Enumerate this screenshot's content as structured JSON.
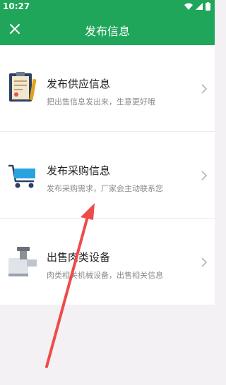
{
  "status_bar": {
    "time": "10:27"
  },
  "app_bar": {
    "title": "发布信息"
  },
  "items": [
    {
      "title": "发布供应信息",
      "subtitle": "把出售信息发出来，生意更好哦"
    },
    {
      "title": "发布采购信息",
      "subtitle": "发布采购需求，厂家会主动联系您"
    },
    {
      "title": "出售肉类设备",
      "subtitle": "肉类相关机械设备，出售相关信息"
    }
  ],
  "colors": {
    "brand": "#1fa65a",
    "annotation_arrow": "#ee4b4b"
  }
}
